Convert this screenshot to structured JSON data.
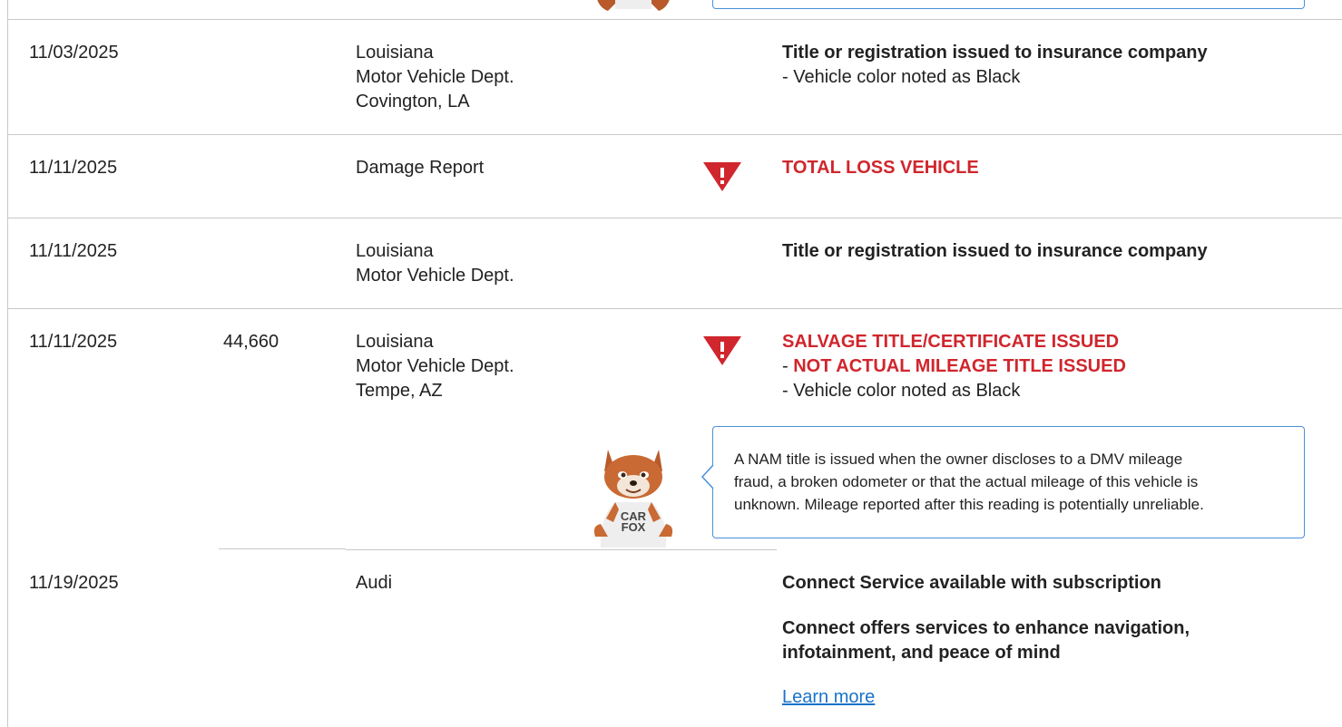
{
  "rows": [
    {
      "date": "11/03/2025",
      "mileage": "",
      "source": [
        "Louisiana",
        "Motor Vehicle Dept.",
        "Covington, LA"
      ],
      "comments_bold": "Title or registration issued to insurance company",
      "comments_lines": [
        "- Vehicle color noted as Black"
      ]
    },
    {
      "date": "11/11/2025",
      "mileage": "",
      "source": [
        "Damage Report"
      ],
      "alert": "TOTAL LOSS VEHICLE"
    },
    {
      "date": "11/11/2025",
      "mileage": "",
      "source": [
        "Louisiana",
        "Motor Vehicle Dept."
      ],
      "comments_bold": "Title or registration issued to insurance company"
    },
    {
      "date": "11/11/2025",
      "mileage": "44,660",
      "source": [
        "Louisiana",
        "Motor Vehicle Dept.",
        "Tempe, AZ"
      ],
      "alert": "SALVAGE TITLE/CERTIFICATE ISSUED",
      "alert2_prefix": "- ",
      "alert2": "NOT ACTUAL MILEAGE TITLE ISSUED",
      "comments_lines": [
        "- Vehicle color noted as Black"
      ],
      "callout": [
        "A NAM title is issued when the owner discloses to a DMV mileage",
        "fraud, a broken odometer or that the actual mileage of this vehicle is",
        "unknown. Mileage reported after this reading is potentially unreliable."
      ]
    },
    {
      "date": "11/19/2025",
      "mileage": "",
      "source": [
        "Audi"
      ],
      "comments_bold": "Connect Service available with subscription",
      "comments_bold2": [
        "Connect offers services to enhance navigation,",
        "infotainment, and peace of mind"
      ],
      "link": "Learn more"
    }
  ],
  "mascot": {
    "shirt_line1": "CAR",
    "shirt_line2": "FOX"
  },
  "colors": {
    "alert_red": "#d0262d",
    "callout_border": "#4a90d9",
    "link_blue": "#1a73c8"
  },
  "icons": [
    "warning-triangle-icon",
    "carfox-mascot"
  ]
}
